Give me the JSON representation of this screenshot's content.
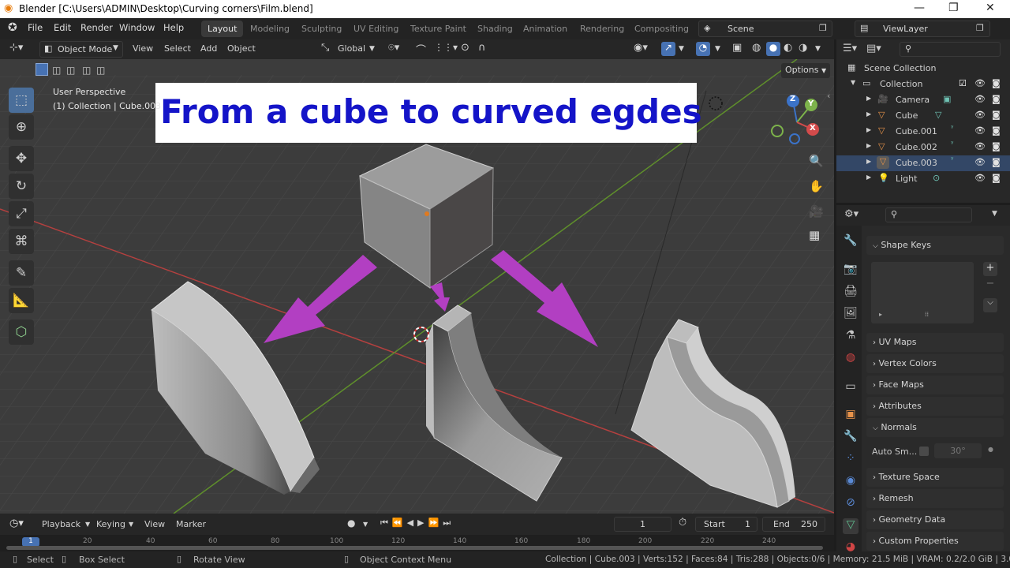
{
  "window": {
    "title": "Blender [C:\\Users\\ADMIN\\Desktop\\Curving corners\\Film.blend]"
  },
  "menu": {
    "items": [
      "File",
      "Edit",
      "Render",
      "Window",
      "Help"
    ]
  },
  "workspaces": [
    "Layout",
    "Modeling",
    "Sculpting",
    "UV Editing",
    "Texture Paint",
    "Shading",
    "Animation",
    "Rendering",
    "Compositing"
  ],
  "scene": {
    "name": "Scene"
  },
  "view_layer": {
    "name": "ViewLayer"
  },
  "viewport_header": {
    "mode": "Object Mode",
    "menus": [
      "View",
      "Select",
      "Add",
      "Object"
    ],
    "orientation": "Global",
    "options": "Options"
  },
  "viewport": {
    "perspective": "User Perspective",
    "context": "(1) Collection | Cube.003",
    "overlay_title": "From a cube to curved egdes",
    "gizmo": {
      "z": "Z",
      "y": "Y",
      "x": "X"
    }
  },
  "outliner": {
    "root": "Scene Collection",
    "collection": "Collection",
    "items": [
      "Camera",
      "Cube",
      "Cube.001",
      "Cube.002",
      "Cube.003",
      "Light"
    ]
  },
  "properties": {
    "shape_keys": "Shape Keys",
    "panels": [
      "UV Maps",
      "Vertex Colors",
      "Face Maps",
      "Attributes"
    ],
    "normals": {
      "label": "Normals",
      "auto_smooth": "Auto Sm...",
      "angle": "30°"
    },
    "more_panels": [
      "Texture Space",
      "Remesh",
      "Geometry Data",
      "Custom Properties"
    ]
  },
  "timeline": {
    "menus": [
      "Playback",
      "Keying",
      "View",
      "Marker"
    ],
    "current_frame": "1",
    "start_label": "Start",
    "start": "1",
    "end_label": "End",
    "end": "250",
    "ruler": [
      "1",
      "20",
      "40",
      "60",
      "80",
      "100",
      "120",
      "140",
      "160",
      "180",
      "200",
      "220",
      "240"
    ]
  },
  "status": {
    "select": "Select",
    "box_select": "Box Select",
    "rotate_view": "Rotate View",
    "context_menu": "Object Context Menu",
    "stats": "Collection | Cube.003 | Verts:152 | Faces:84 | Tris:288 | Objects:0/6 | Memory: 21.5 MiB | VRAM: 0.2/2.0 GiB | 3.0.0"
  },
  "colors": {
    "accent": "#4772b3",
    "arrow": "#b23fc2",
    "title_text": "#1414c8",
    "axis_x": "#c83c3c",
    "axis_y": "#6a9a2e"
  }
}
